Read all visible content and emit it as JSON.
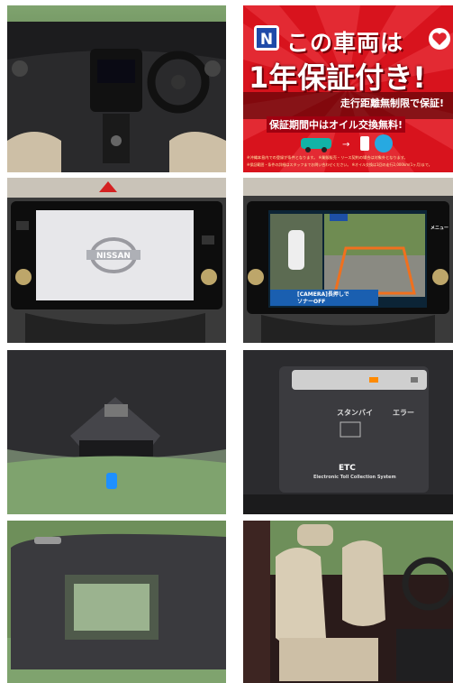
{
  "promo": {
    "logo_letter": "N",
    "headline_1": "この車両は",
    "headline_2": "1年保証付き!",
    "sub_1": "走行距離無制限で保証!",
    "sub_2": "保証期間中はオイル交換無料!",
    "note_1": "※沖縄本島内での登録が条件となります。 ※業販販売・リース契約の場合は対象外となります。",
    "note_2": "※保証範囲・条件の詳細はスタッフまでお問い合わせください。 ※オイル交換は1回の走行2,000km(1ヶ月)まで。",
    "colors": {
      "red": "#d8131d",
      "yellow": "#ffe14a"
    }
  },
  "navi": {
    "brand": "NISSAN",
    "menu_label": "メニュー",
    "camera_hint": "[CAMERA]長押しで",
    "camera_hint_2": "ソナーOFF"
  },
  "etc": {
    "standby": "スタンバイ",
    "error": "エラー",
    "logo": "ETC",
    "subtitle": "Electronic Toll Collection System"
  }
}
